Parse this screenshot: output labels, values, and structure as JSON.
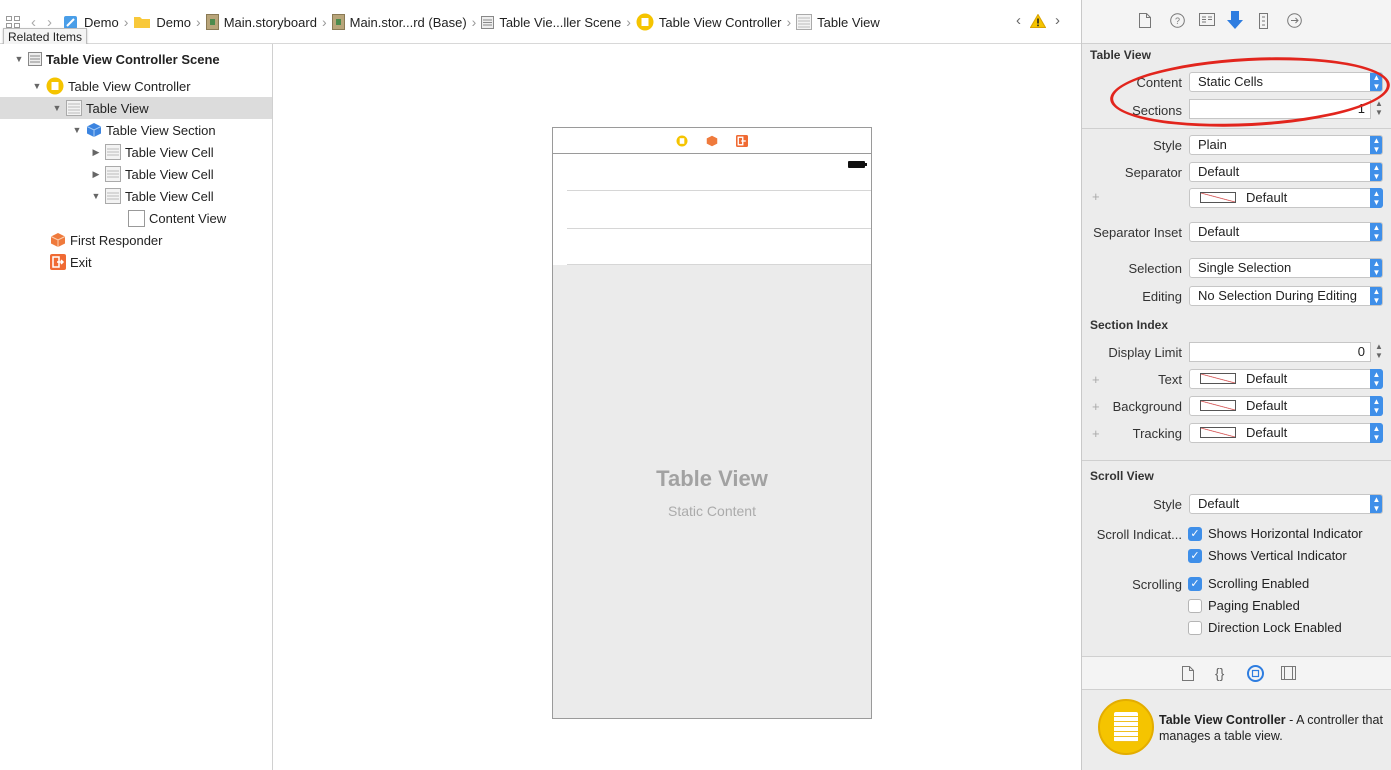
{
  "jumpbar": {
    "tooltip": "Related Items",
    "crumbs": [
      "Demo",
      "Demo",
      "Main.storyboard",
      "Main.stor...rd (Base)",
      "Table Vie...ller Scene",
      "Table View Controller",
      "Table View"
    ]
  },
  "outline": {
    "items": [
      {
        "label": "Table View Controller Scene"
      },
      {
        "label": "Table View Controller"
      },
      {
        "label": "Table View"
      },
      {
        "label": "Table View Section"
      },
      {
        "label": "Table View Cell"
      },
      {
        "label": "Table View Cell"
      },
      {
        "label": "Table View Cell"
      },
      {
        "label": "Content View"
      },
      {
        "label": "First Responder"
      },
      {
        "label": "Exit"
      }
    ]
  },
  "canvas": {
    "title": "Table View",
    "subtitle": "Static Content"
  },
  "inspector": {
    "table_view": {
      "header": "Table View",
      "content_label": "Content",
      "content_value": "Static Cells",
      "sections_label": "Sections",
      "sections_value": "1",
      "style_label": "Style",
      "style_value": "Plain",
      "separator_label": "Separator",
      "separator_value": "Default",
      "separator_color": "Default",
      "inset_label": "Separator Inset",
      "inset_value": "Default",
      "selection_label": "Selection",
      "selection_value": "Single Selection",
      "editing_label": "Editing",
      "editing_value": "No Selection During Editing"
    },
    "section_index": {
      "header": "Section Index",
      "limit_label": "Display Limit",
      "limit_value": "0",
      "text_label": "Text",
      "text_value": "Default",
      "bg_label": "Background",
      "bg_value": "Default",
      "tracking_label": "Tracking",
      "tracking_value": "Default"
    },
    "scroll_view": {
      "header": "Scroll View",
      "style_label": "Style",
      "style_value": "Default",
      "indicators_label": "Scroll Indicat...",
      "shows_horizontal": "Shows Horizontal Indicator",
      "shows_vertical": "Shows Vertical Indicator",
      "scrolling_label": "Scrolling",
      "scrolling_enabled": "Scrolling Enabled",
      "paging_enabled": "Paging Enabled",
      "direction_lock": "Direction Lock Enabled"
    },
    "library": {
      "name": "Table View Controller",
      "description": " - A controller that manages a table view."
    }
  },
  "colors": {
    "accent": "#3f8fe9",
    "annotation": "#e2251d",
    "warning": "#f5c400"
  }
}
